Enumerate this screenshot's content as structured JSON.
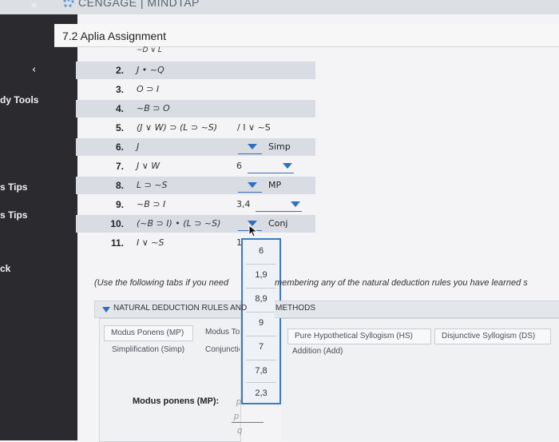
{
  "topbar": {
    "collapse_icon": "«",
    "brand": "CENGAGE | MINDTAP"
  },
  "sidebar": {
    "items": [
      "dy Tools",
      "s Tips",
      "s Tips",
      "ck"
    ],
    "chevron": "‹"
  },
  "page": {
    "title": "7.2 Aplia Assignment"
  },
  "proof": {
    "partial_top": "~D ∨ L",
    "rows": [
      {
        "num": "2.",
        "formula": "J • ~Q"
      },
      {
        "num": "3.",
        "formula": "O ⊃ I"
      },
      {
        "num": "4.",
        "formula": "~B ⊃ O"
      },
      {
        "num": "5.",
        "formula": "(J ∨ W) ⊃ (L ⊃ ~S)",
        "conclusion": "/ I ∨ ~S"
      },
      {
        "num": "6.",
        "formula": "J",
        "rule": "Simp"
      },
      {
        "num": "7.",
        "formula": "J ∨ W",
        "line_ref": "6"
      },
      {
        "num": "8.",
        "formula": "L ⊃ ~S",
        "rule": "MP"
      },
      {
        "num": "9.",
        "formula": "~B ⊃ I",
        "line_ref": "3,4"
      },
      {
        "num": "10.",
        "formula": "(~B ⊃ I) • (L ⊃ ~S)",
        "rule": "Conj"
      },
      {
        "num": "11.",
        "formula": "I ∨ ~S",
        "line_ref": "1"
      }
    ]
  },
  "listbox": {
    "options": [
      "6",
      "1,9",
      "8,9",
      "9",
      "7",
      "7,8",
      "2,3"
    ]
  },
  "help": {
    "start": "(Use the following tabs if you need",
    "end": "membering any of the natural deduction rules you have learned s"
  },
  "rules_section": {
    "header_start": "NATURAL DEDUCTION RULES AND",
    "header_end": "METHODS",
    "tabs_left": [
      "Modus Ponens (MP)",
      "Modus To",
      "Simplification (Simp)",
      "Conjunctio"
    ],
    "tabs_right": [
      "Pure Hypothetical Syllogism (HS)",
      "Disjunctive Syllogism (DS)",
      "Addition (Add)"
    ]
  },
  "modus_ponens": {
    "label": "Modus ponens (MP):",
    "p1": "p",
    "p2": "p",
    "q": "q"
  }
}
